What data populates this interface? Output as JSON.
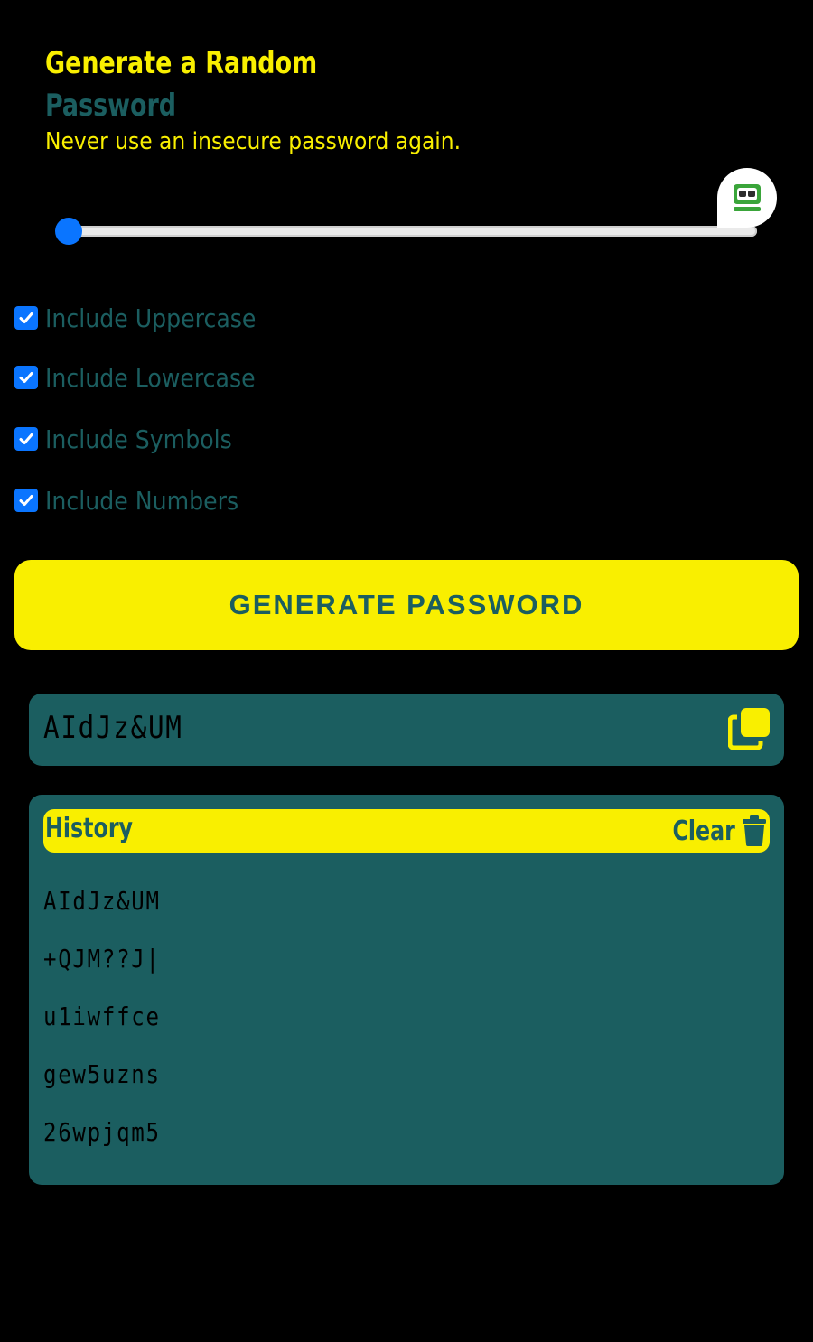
{
  "header": {
    "title_line1": "Generate a Random",
    "title_line2": "Password",
    "subtitle": "Never use an insecure password again."
  },
  "length_slider": {
    "value_fraction": 0.0
  },
  "options": [
    {
      "label": "Include Uppercase",
      "checked": true
    },
    {
      "label": "Include Lowercase",
      "checked": true
    },
    {
      "label": "Include Symbols",
      "checked": true
    },
    {
      "label": "Include Numbers",
      "checked": true
    }
  ],
  "generate_button": {
    "label": "GENERATE PASSWORD"
  },
  "output": {
    "password": "AIdJz&UM",
    "copy_icon": "copy-icon"
  },
  "history": {
    "title": "History",
    "clear_label": "Clear",
    "clear_icon": "trash-icon",
    "items": [
      "AIdJz&UM",
      "+QJM??J|",
      "u1iwffce",
      "gew5uzns",
      "26wpjqm5"
    ]
  },
  "colors": {
    "background": "#000000",
    "accent_yellow": "#f9ef00",
    "teal": "#1b5e60",
    "checkbox_blue": "#0a75ff"
  }
}
